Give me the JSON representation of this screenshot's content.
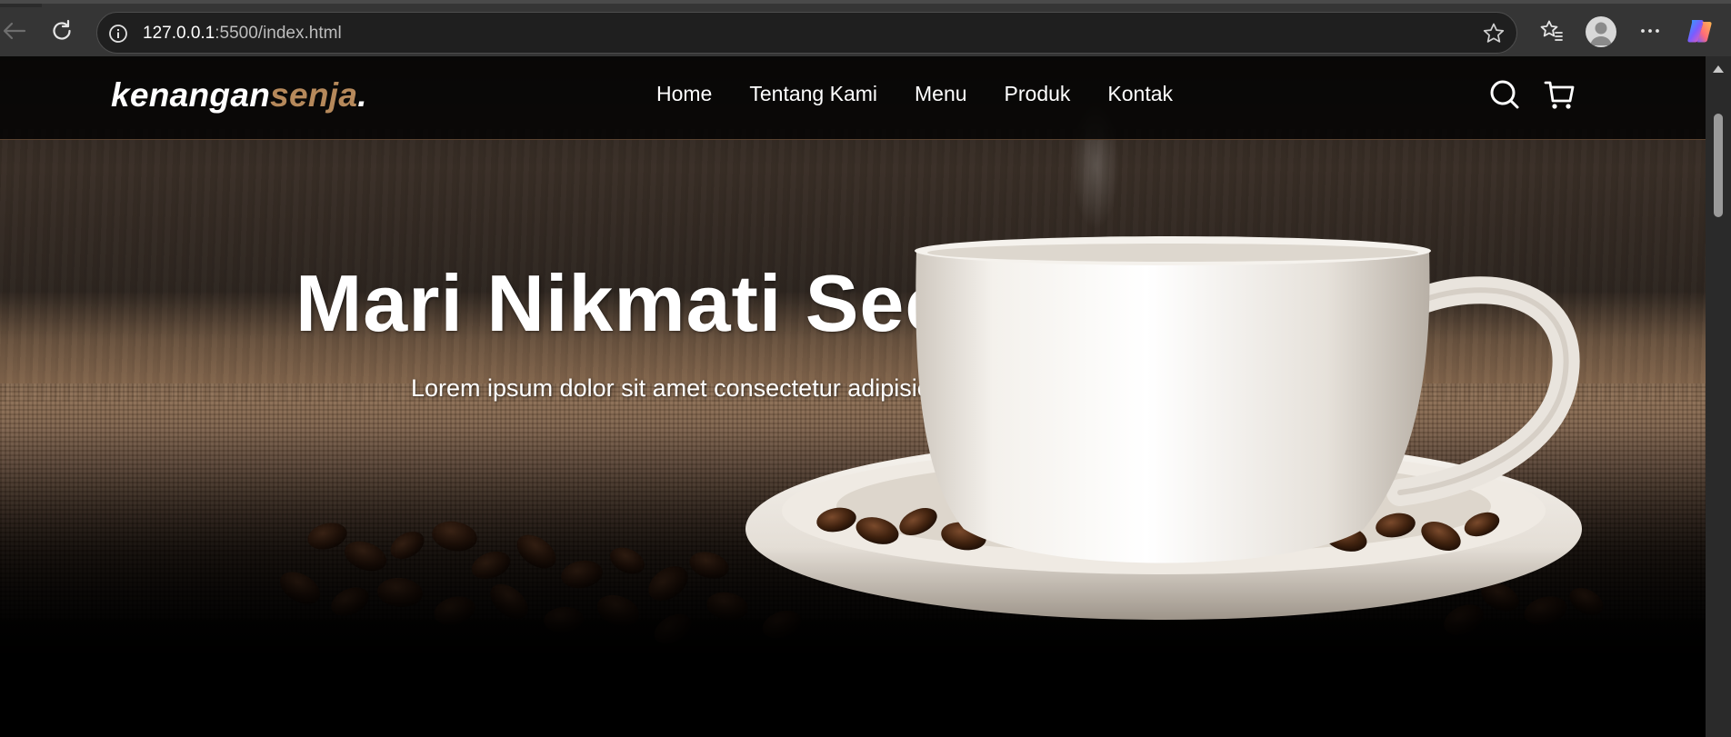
{
  "browser": {
    "url_host": "127.0.0.1",
    "url_path": ":5500/index.html",
    "icons": {
      "back": "back-arrow-icon",
      "reload": "reload-icon",
      "site_info": "info-icon",
      "favorite": "star-icon",
      "favorites": "favorites-icon",
      "profile": "profile-avatar-icon",
      "more": "more-options-icon",
      "copilot": "copilot-icon"
    }
  },
  "site": {
    "logo_main": "kenangan",
    "logo_accent": "senja",
    "logo_dot": ".",
    "accent_color": "#b6895b",
    "nav": [
      {
        "label": "Home"
      },
      {
        "label": "Tentang Kami"
      },
      {
        "label": "Menu"
      },
      {
        "label": "Produk"
      },
      {
        "label": "Kontak"
      }
    ],
    "icons": {
      "search": "search-icon",
      "cart": "shopping-cart-icon"
    }
  },
  "hero": {
    "title": "Mari Nikmati Secangkir Kopi",
    "description": "Lorem ipsum dolor sit amet consectetur adipisicing elit."
  }
}
